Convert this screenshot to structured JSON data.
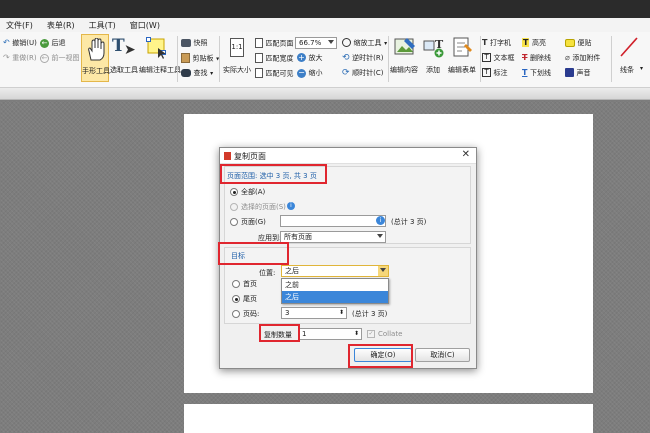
{
  "menubar": {
    "items": [
      "文件(F)",
      "表单(R)",
      "工具(T)",
      "窗口(W)"
    ]
  },
  "ribbon": {
    "undo": "撤销(U)",
    "redo": "重做(R)",
    "back": "后退",
    "prev_view": "前一视图",
    "hand_tool": "手形工具",
    "select_tool": "选取工具",
    "edit_annot": "编辑注释工具",
    "snapshot": "快照",
    "clipboard": "剪贴板",
    "find": "查找",
    "actual_size": "实际大小",
    "actual_size_num": "1:1",
    "fit_page": "匹配页面",
    "fit_width": "匹配宽度",
    "fit_visible": "匹配可见",
    "zoom_value": "66.7%",
    "zoom_tool": "缩放工具",
    "zoom_in": "放大",
    "zoom_out": "缩小",
    "rotate_ccw": "逆时针(R)",
    "rotate_cw": "顺时针(C)",
    "edit_content": "编辑内容",
    "add": "添加",
    "edit_form": "编辑表单",
    "typewriter": "打字机",
    "textbox": "文本框",
    "callout": "标注",
    "highlight": "高亮",
    "strikeout": "删除线",
    "underline": "下划线",
    "sticky_note": "便贴",
    "attach_file": "添加附件",
    "sound": "声音",
    "line": "线条"
  },
  "dialog": {
    "title": "复制页面",
    "page_range": "页面范围: 选中 3 页, 共 3 页",
    "all": "全部(A)",
    "selected_pages": "选择的页面(S)",
    "pages": "页面(G)",
    "pages_total": "(总计 3 页)",
    "apply_to_label": "应用到:",
    "apply_to_value": "所有页面",
    "target": "目标",
    "position_label": "位置:",
    "position_value": "之后",
    "position_options": [
      "之前",
      "之后"
    ],
    "first_page": "首页",
    "last_page": "尾页",
    "page_number": "页码:",
    "page_number_value": "3",
    "page_total2": "(总计 3 页)",
    "copies_label": "复制数量",
    "copies_value": "1",
    "collate": "Collate",
    "ok": "确定(O)",
    "cancel": "取消(C)"
  },
  "colors": {
    "highlight_red": "#e0262f",
    "selection_blue": "#3b86d9"
  }
}
